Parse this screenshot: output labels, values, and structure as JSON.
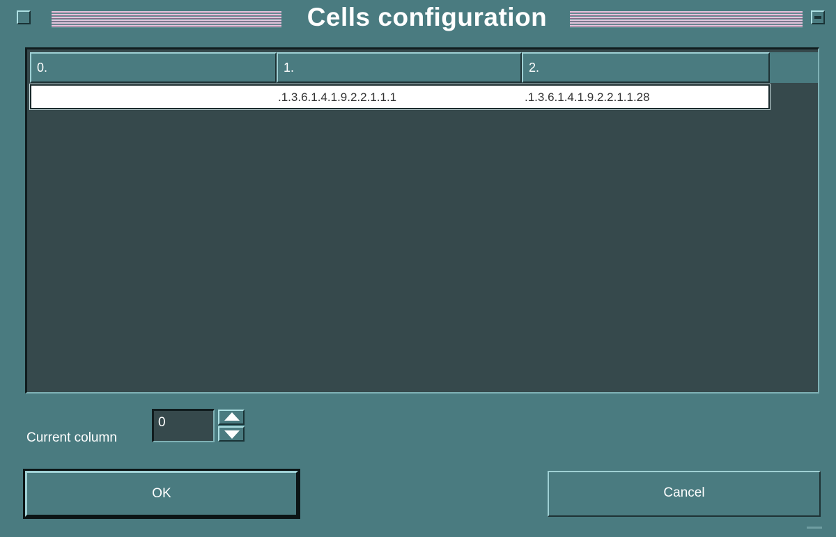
{
  "window": {
    "title": "Cells configuration"
  },
  "table": {
    "columns": [
      "0.",
      "1.",
      "2."
    ],
    "rows": [
      [
        "",
        ".1.3.6.1.4.1.9.2.2.1.1.1",
        ".1.3.6.1.4.1.9.2.2.1.1.28"
      ]
    ]
  },
  "current_column": {
    "label": "Current column",
    "value": "0"
  },
  "buttons": {
    "ok": "OK",
    "cancel": "Cancel"
  },
  "colors": {
    "window_bg": "#4a7b80",
    "table_bg": "#36494c",
    "row_bg": "#ffffff",
    "title_stripes": "#e0c6db"
  },
  "icons": {
    "window_menu": "square-button-icon",
    "minimize": "minimize-icon",
    "spin_up": "triangle-up-icon",
    "spin_down": "triangle-down-icon"
  }
}
